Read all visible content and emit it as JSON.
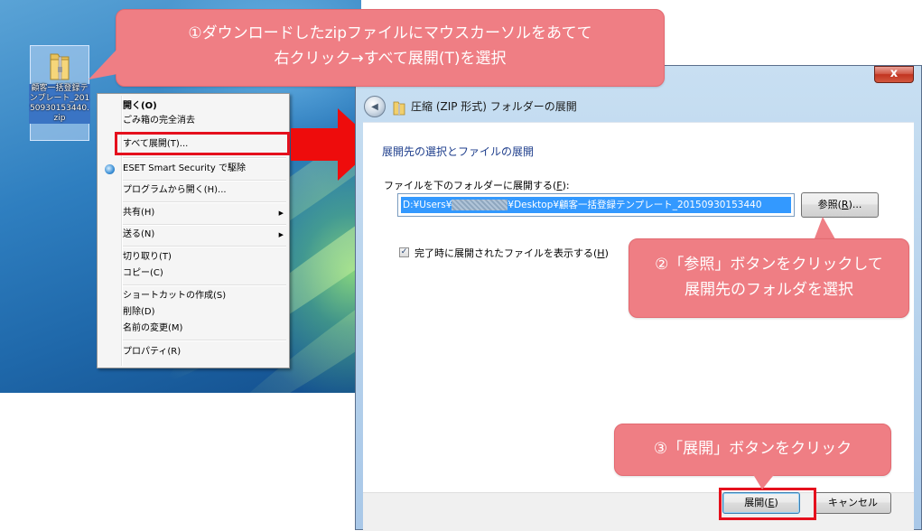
{
  "desktop": {
    "file_icon_label": "顧客一括登録テンプレート_20150930153440.zip"
  },
  "context_menu": {
    "items": [
      {
        "label": "開く(O)",
        "bold": true
      },
      {
        "label": "ごみ箱の完全消去"
      },
      {
        "label": "すべて展開(T)..."
      },
      {
        "label": "ESET Smart Security で駆除"
      },
      {
        "label": "プログラムから開く(H)..."
      },
      {
        "label": "共有(H)"
      },
      {
        "label": "送る(N)"
      },
      {
        "label": "切り取り(T)"
      },
      {
        "label": "コピー(C)"
      },
      {
        "label": "ショートカットの作成(S)"
      },
      {
        "label": "削除(D)"
      },
      {
        "label": "名前の変更(M)"
      },
      {
        "label": "プロパティ(R)"
      }
    ],
    "submenu_arrow": "▶"
  },
  "callouts": {
    "step1_line1": "①ダウンロードしたzipファイルにマウスカーソルをあてて",
    "step1_line2": "右クリック→すべて展開(T)を選択",
    "step2_line1": "②「参照」ボタンをクリックして",
    "step2_line2": "展開先のフォルダを選択",
    "step3": "③「展開」ボタンをクリック"
  },
  "dialog": {
    "close_label": "x",
    "back_glyph": "◀",
    "title": "圧縮 (ZIP 形式) フォルダーの展開",
    "heading": "展開先の選択とファイルの展開",
    "dest_label_main": "ファイルを下のフォルダーに展開する(",
    "dest_label_key": "F",
    "dest_label_end": "):",
    "path_prefix": "D:¥Users¥",
    "path_suffix": "¥Desktop¥顧客一括登録テンプレート_20150930153440",
    "browse_main": "参照(",
    "browse_key": "R",
    "browse_end": ")...",
    "checkbox_mark": "✓",
    "checkbox_main": "完了時に展開されたファイルを表示する(",
    "checkbox_key": "H",
    "checkbox_end": ")",
    "extract_main": "展開(",
    "extract_key": "E",
    "extract_end": ")",
    "cancel_label": "キャンセル"
  }
}
